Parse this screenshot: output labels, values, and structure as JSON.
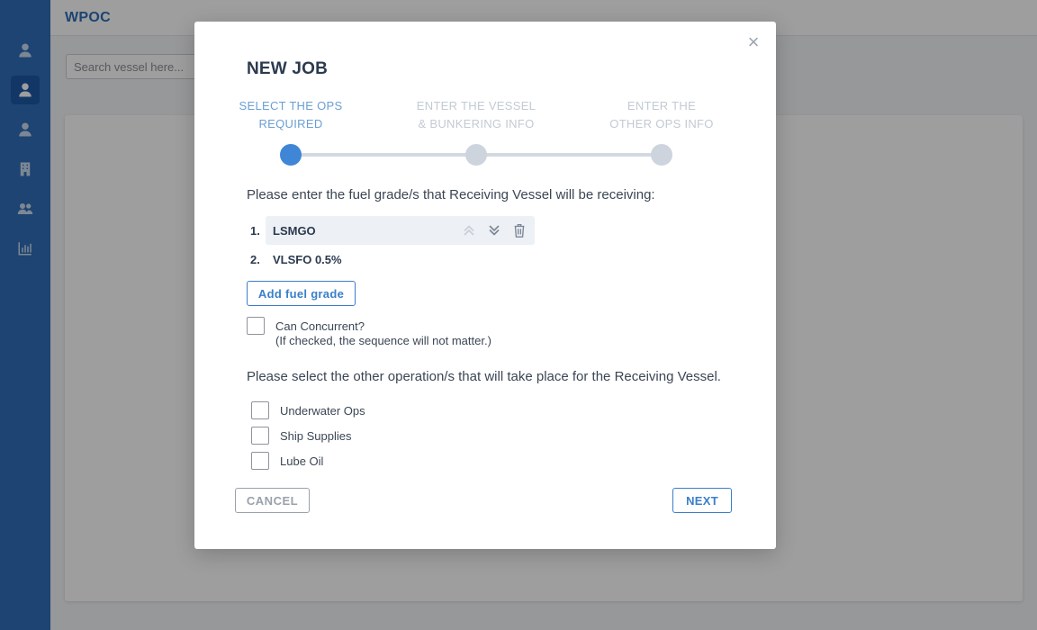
{
  "app": {
    "brand": "WPOC",
    "search_placeholder": "Search vessel here...",
    "sidebar_icons": [
      "user-icon",
      "user-icon",
      "user-icon",
      "building-icon",
      "users-icon",
      "chart-icon"
    ],
    "active_sidebar_index": 1
  },
  "modal": {
    "title": "NEW JOB",
    "close_icon": "close-icon",
    "steps": [
      {
        "line1": "SELECT THE OPS",
        "line2": "REQUIRED",
        "active": true
      },
      {
        "line1": "ENTER THE VESSEL",
        "line2": "& BUNKERING INFO",
        "active": false
      },
      {
        "line1": "ENTER THE",
        "line2": "OTHER OPS INFO",
        "active": false
      }
    ],
    "fuel_prompt": "Please enter the fuel grade/s that Receiving Vessel will be receiving:",
    "fuel_grades": [
      {
        "num": "1.",
        "name": "LSMGO"
      },
      {
        "num": "2.",
        "name": "VLSFO 0.5%"
      }
    ],
    "add_fuel_label": "Add fuel grade",
    "concurrent": {
      "label": "Can Concurrent?",
      "sub": "(If checked, the sequence will not matter.)",
      "checked": false
    },
    "ops_prompt": "Please select the other operation/s that will take place for the Receiving Vessel.",
    "ops": [
      {
        "label": "Underwater Ops",
        "checked": false
      },
      {
        "label": "Ship Supplies",
        "checked": false
      },
      {
        "label": "Lube Oil",
        "checked": false
      }
    ],
    "cancel_label": "CANCEL",
    "next_label": "NEXT"
  },
  "colors": {
    "sidebar": "#2f6eb9",
    "accent": "#3a7fc9",
    "active_step": "#3f86d6",
    "inactive_step": "#cdd4de"
  }
}
